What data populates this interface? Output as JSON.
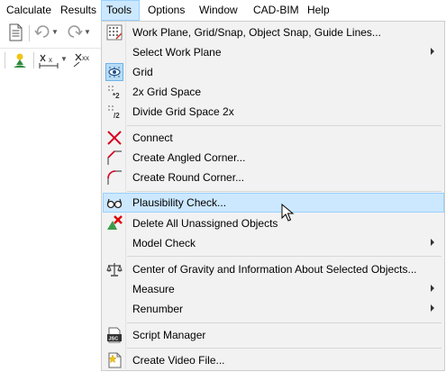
{
  "menubar": {
    "items": [
      {
        "label": "Calculate"
      },
      {
        "label": "Results"
      },
      {
        "label": "Tools"
      },
      {
        "label": "Options"
      },
      {
        "label": "Window"
      },
      {
        "label": "CAD-BIM"
      },
      {
        "label": "Help"
      }
    ],
    "active_index": 2
  },
  "toolbar": {
    "icons": [
      "document-icon",
      "undo-icon",
      "redo-icon",
      "person-icon",
      "dimension-x-icon",
      "dimension-xx-icon"
    ],
    "label_x": "x",
    "label_xx": "xx"
  },
  "menu": {
    "items": [
      {
        "label": "Work Plane, Grid/Snap, Object Snap, Guide Lines...",
        "icon": "work-plane-icon"
      },
      {
        "label": "Select Work Plane",
        "icon": "none",
        "submenu": true
      },
      {
        "label": "Grid",
        "icon": "grid-eye-icon",
        "checked": true
      },
      {
        "label": "2x Grid Space",
        "icon": "grid-double-icon"
      },
      {
        "label": "Divide Grid Space 2x",
        "icon": "grid-divide-icon"
      },
      {
        "label": "Connect",
        "icon": "connect-cross-icon"
      },
      {
        "label": "Create Angled Corner...",
        "icon": "angled-corner-icon"
      },
      {
        "label": "Create Round Corner...",
        "icon": "round-corner-icon"
      },
      {
        "label": "Plausibility Check...",
        "icon": "glasses-icon",
        "highlighted": true
      },
      {
        "label": "Delete All Unassigned Objects",
        "icon": "delete-objects-icon"
      },
      {
        "label": "Model Check",
        "icon": "none",
        "submenu": true
      },
      {
        "label": "Center of Gravity and Information About Selected Objects...",
        "icon": "balance-scale-icon"
      },
      {
        "label": "Measure",
        "icon": "none",
        "submenu": true
      },
      {
        "label": "Renumber",
        "icon": "none",
        "submenu": true
      },
      {
        "label": "Script Manager",
        "icon": "script-icon"
      },
      {
        "label": "Create Video File...",
        "icon": "video-file-icon"
      }
    ],
    "icon_labels": {
      "grid_double": "*2",
      "grid_divide": "/2",
      "script": "JSC"
    }
  },
  "colors": {
    "highlight_bg": "#cce8ff",
    "highlight_border": "#99d1ff",
    "menu_bg": "#f2f2f2",
    "connect_red": "#d9001b",
    "delete_red": "#e00000"
  }
}
